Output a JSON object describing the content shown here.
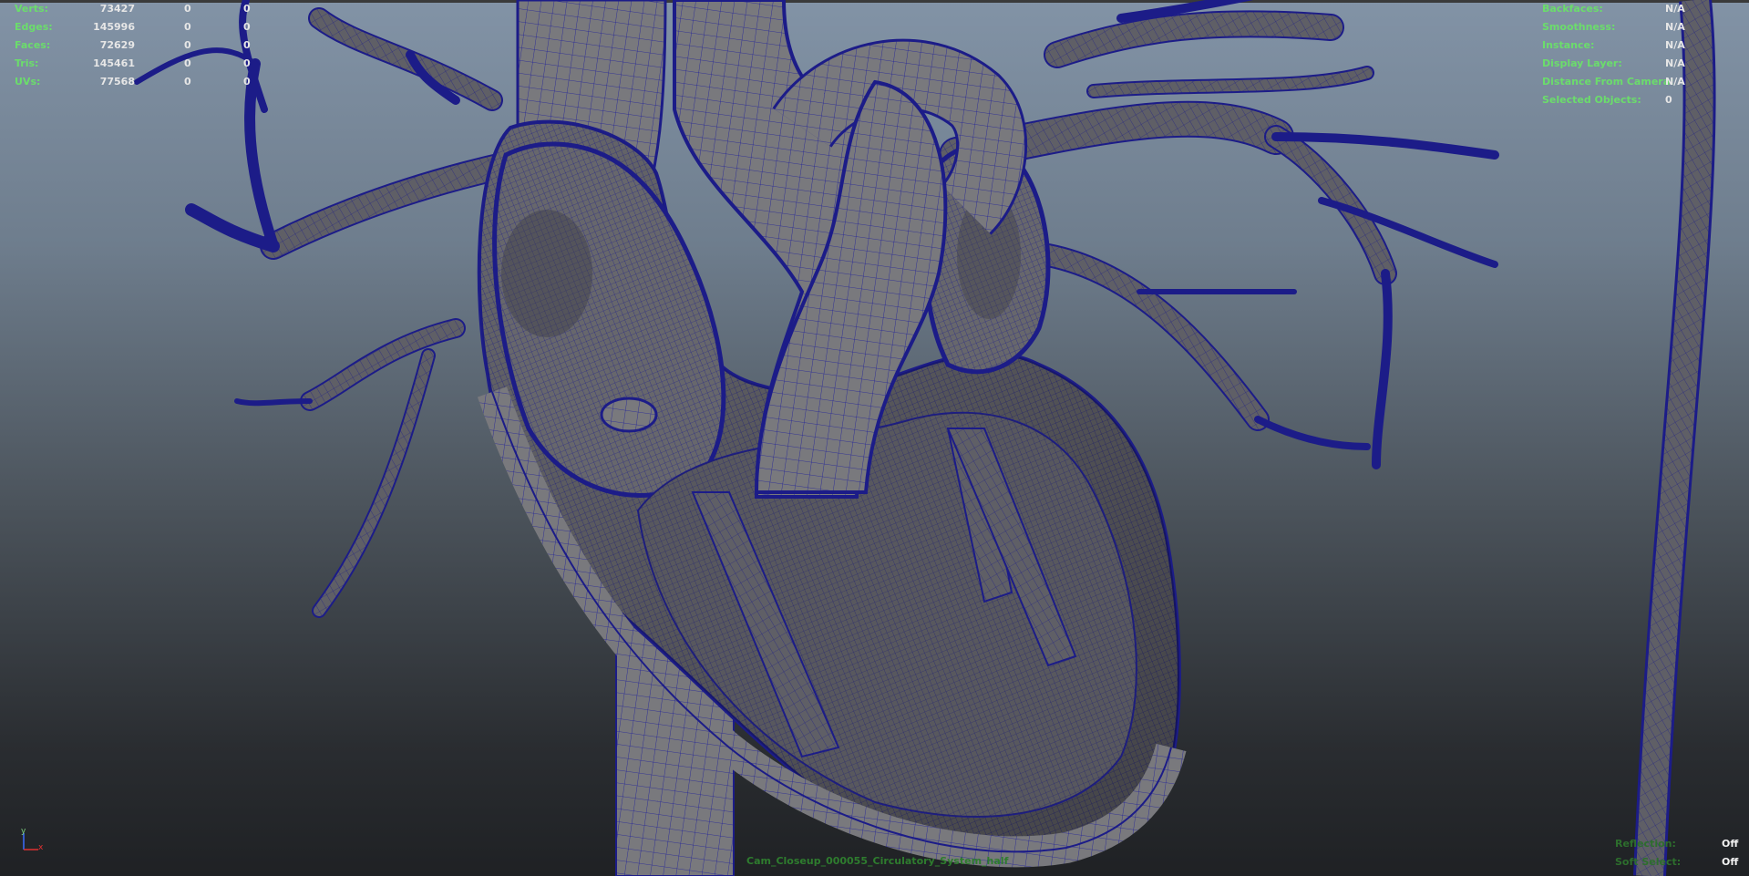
{
  "stats": {
    "rows": [
      {
        "label": "Verts:",
        "v1": "73427",
        "v2": "0",
        "v3": "0"
      },
      {
        "label": "Edges:",
        "v1": "145996",
        "v2": "0",
        "v3": "0"
      },
      {
        "label": "Faces:",
        "v1": "72629",
        "v2": "0",
        "v3": "0"
      },
      {
        "label": "Tris:",
        "v1": "145461",
        "v2": "0",
        "v3": "0"
      },
      {
        "label": "UVs:",
        "v1": "77568",
        "v2": "0",
        "v3": "0"
      }
    ]
  },
  "info": {
    "rows": [
      {
        "label": "Backfaces:",
        "value": "N/A"
      },
      {
        "label": "Smoothness:",
        "value": "N/A"
      },
      {
        "label": "Instance:",
        "value": "N/A"
      },
      {
        "label": "Display Layer:",
        "value": "N/A"
      },
      {
        "label": "Distance From Camera:",
        "value": "N/A"
      },
      {
        "label": "Selected Objects:",
        "value": "0"
      }
    ]
  },
  "toggles": {
    "rows": [
      {
        "label": "Reflection:",
        "value": "Off"
      },
      {
        "label": "Soft Select:",
        "value": "Off"
      }
    ]
  },
  "camera": {
    "name": "Cam_Closeup_000055_Circulatory_System_half"
  },
  "axis": {
    "y_label": "y",
    "x_label": "x"
  },
  "colors": {
    "hud_text": "#6bdd6b",
    "wire": "#1e1e96",
    "surface": "#6f6f72",
    "background_top": "#8293a6",
    "background_bottom": "#1f2124"
  }
}
